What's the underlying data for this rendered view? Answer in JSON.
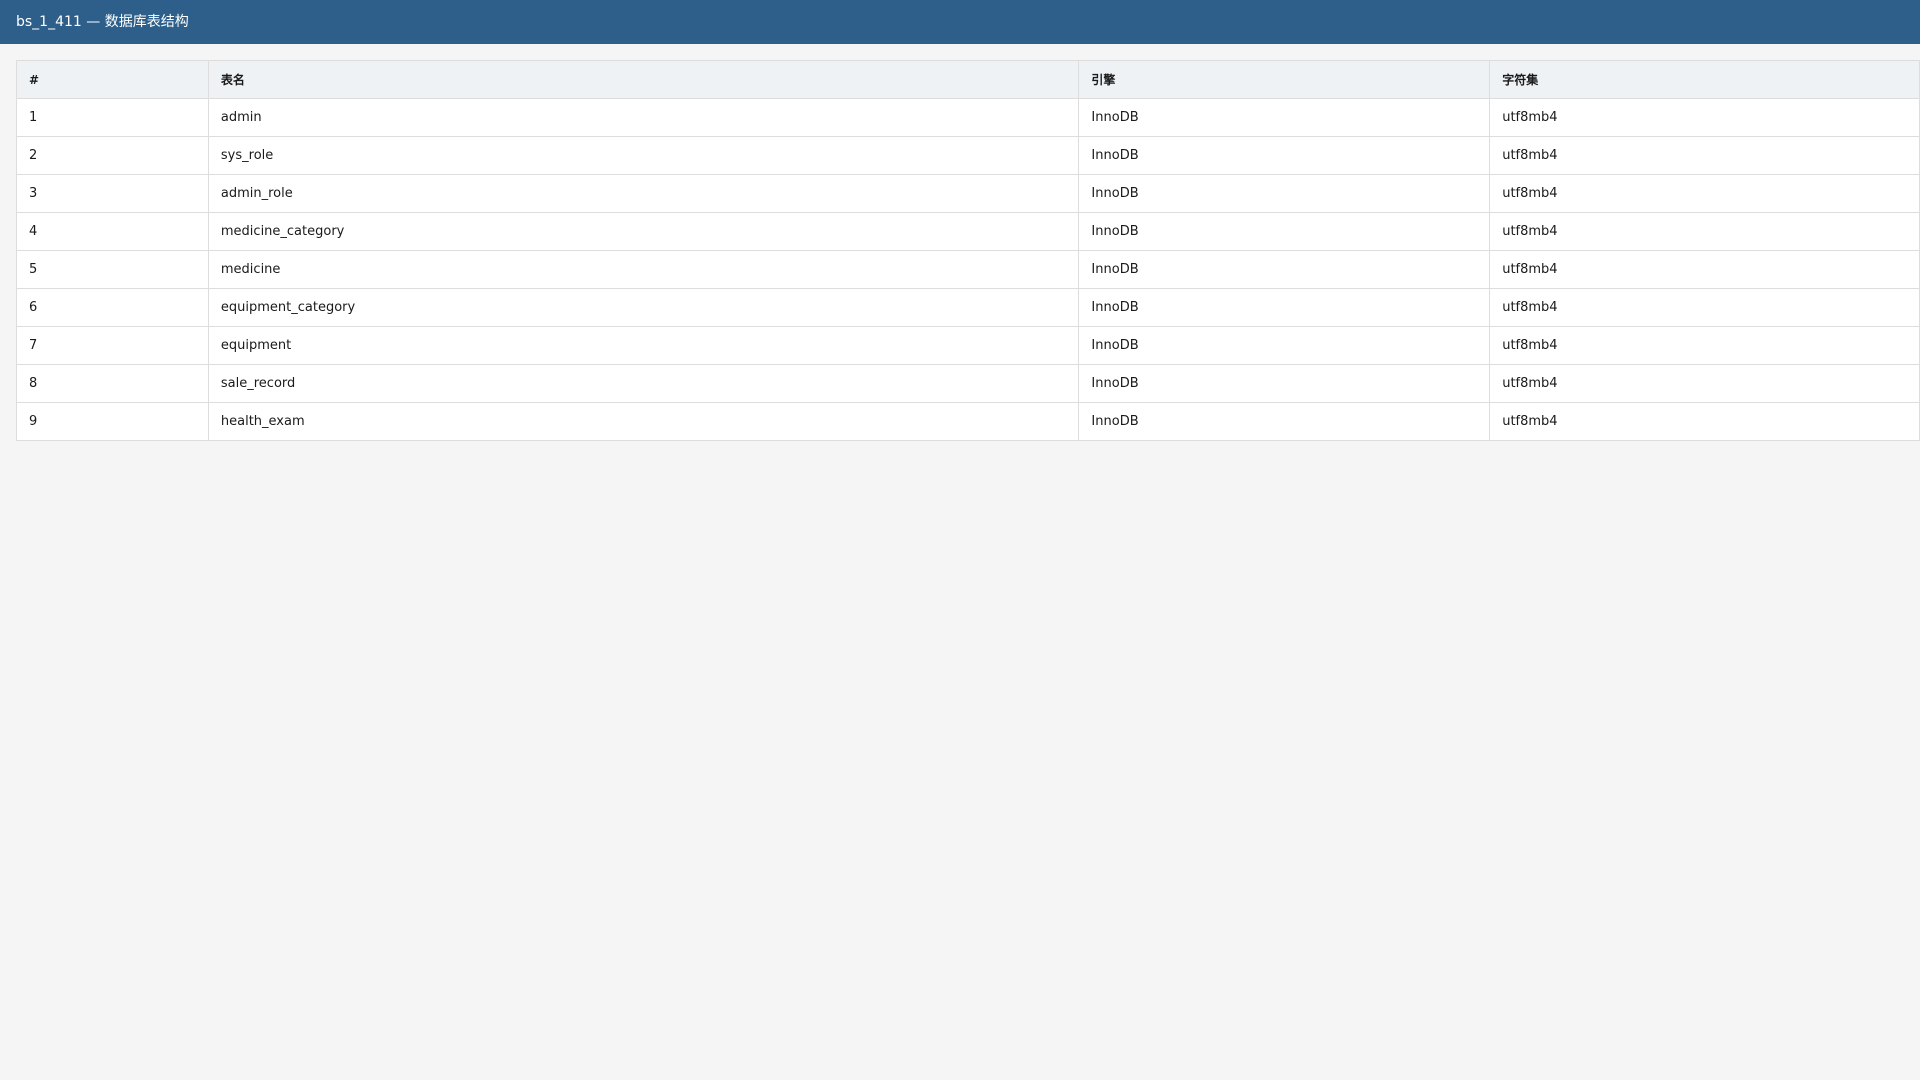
{
  "window": {
    "title": "bs_1_411 — 数据库表结构"
  },
  "table": {
    "headers": [
      "#",
      "表名",
      "引擎",
      "字符集"
    ],
    "rows": [
      {
        "num": "1",
        "name": "admin",
        "engine": "InnoDB",
        "charset": "utf8mb4"
      },
      {
        "num": "2",
        "name": "sys_role",
        "engine": "InnoDB",
        "charset": "utf8mb4"
      },
      {
        "num": "3",
        "name": "admin_role",
        "engine": "InnoDB",
        "charset": "utf8mb4"
      },
      {
        "num": "4",
        "name": "medicine_category",
        "engine": "InnoDB",
        "charset": "utf8mb4"
      },
      {
        "num": "5",
        "name": "medicine",
        "engine": "InnoDB",
        "charset": "utf8mb4"
      },
      {
        "num": "6",
        "name": "equipment_category",
        "engine": "InnoDB",
        "charset": "utf8mb4"
      },
      {
        "num": "7",
        "name": "equipment",
        "engine": "InnoDB",
        "charset": "utf8mb4"
      },
      {
        "num": "8",
        "name": "sale_record",
        "engine": "InnoDB",
        "charset": "utf8mb4"
      },
      {
        "num": "9",
        "name": "health_exam",
        "engine": "InnoDB",
        "charset": "utf8mb4"
      }
    ]
  }
}
